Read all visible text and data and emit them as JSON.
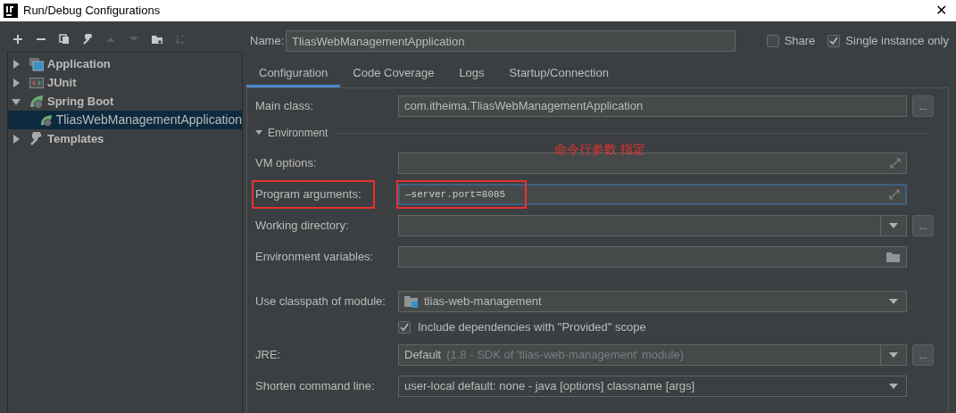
{
  "window": {
    "title": "Run/Debug Configurations",
    "close": "✕"
  },
  "toolbar": [
    {
      "kind": "add",
      "disabled": false
    },
    {
      "kind": "remove",
      "disabled": false
    },
    {
      "kind": "copy",
      "disabled": false
    },
    {
      "kind": "wrench",
      "disabled": false
    },
    {
      "kind": "up",
      "disabled": true
    },
    {
      "kind": "down",
      "disabled": true
    },
    {
      "kind": "folder",
      "disabled": false
    },
    {
      "kind": "sort",
      "disabled": true
    }
  ],
  "tree": [
    {
      "label": "Application",
      "kind": "application",
      "expanded": false,
      "selected": false
    },
    {
      "label": "JUnit",
      "kind": "junit",
      "expanded": false,
      "selected": false
    },
    {
      "label": "Spring Boot",
      "kind": "spring",
      "expanded": true,
      "selected": false,
      "children": [
        {
          "label": "TliasWebManagementApplication",
          "kind": "spring",
          "selected": true
        }
      ]
    },
    {
      "label": "Templates",
      "kind": "wrench",
      "expanded": false,
      "selected": false
    }
  ],
  "name_field": {
    "label": "Name:",
    "value": "TliasWebManagementApplication"
  },
  "options": [
    {
      "label": "Share",
      "checked": false
    },
    {
      "label": "Single instance only",
      "checked": true
    }
  ],
  "tabs": [
    {
      "label": "Configuration",
      "selected": true
    },
    {
      "label": "Code Coverage",
      "selected": false
    },
    {
      "label": "Logs",
      "selected": false
    },
    {
      "label": "Startup/Connection",
      "selected": false
    }
  ],
  "main_rows": [
    {
      "kind": "field",
      "label": "Main class:",
      "value": "com.itheima.TliasWebManagementApplication",
      "browse": "..."
    }
  ],
  "section": {
    "label": "Environment",
    "expanded": true
  },
  "annotation": {
    "text": "命令行参数 指定"
  },
  "environment_rows": [
    {
      "kind": "field",
      "label": "VM options:",
      "expand_button": true
    },
    {
      "kind": "field",
      "label": "Program arguments:",
      "value": "—server.port=8085",
      "expand_button": true,
      "focused": true,
      "highlighted": true
    },
    {
      "kind": "field",
      "label": "Working directory:",
      "dropdown": true,
      "browse": "..."
    },
    {
      "kind": "field",
      "label": "Environment variables:",
      "folder_button": true
    }
  ],
  "module_rows": [
    {
      "kind": "field",
      "label": "Use classpath of module:",
      "value": "tlias-web-management",
      "module_icon": true,
      "dropdown": true
    },
    {
      "kind": "checkbox",
      "label": "Include dependencies with \"Provided\" scope",
      "checked": true
    },
    {
      "kind": "field",
      "label": "JRE:",
      "value": "Default",
      "hint": "(1.8 - SDK of 'tlias-web-management' module)",
      "dropdown": true,
      "browse": "..."
    },
    {
      "kind": "field",
      "label": "Shorten command line:",
      "value": "user-local default: none - java [options] classname [args]",
      "dropdown": true,
      "flat": true
    }
  ]
}
